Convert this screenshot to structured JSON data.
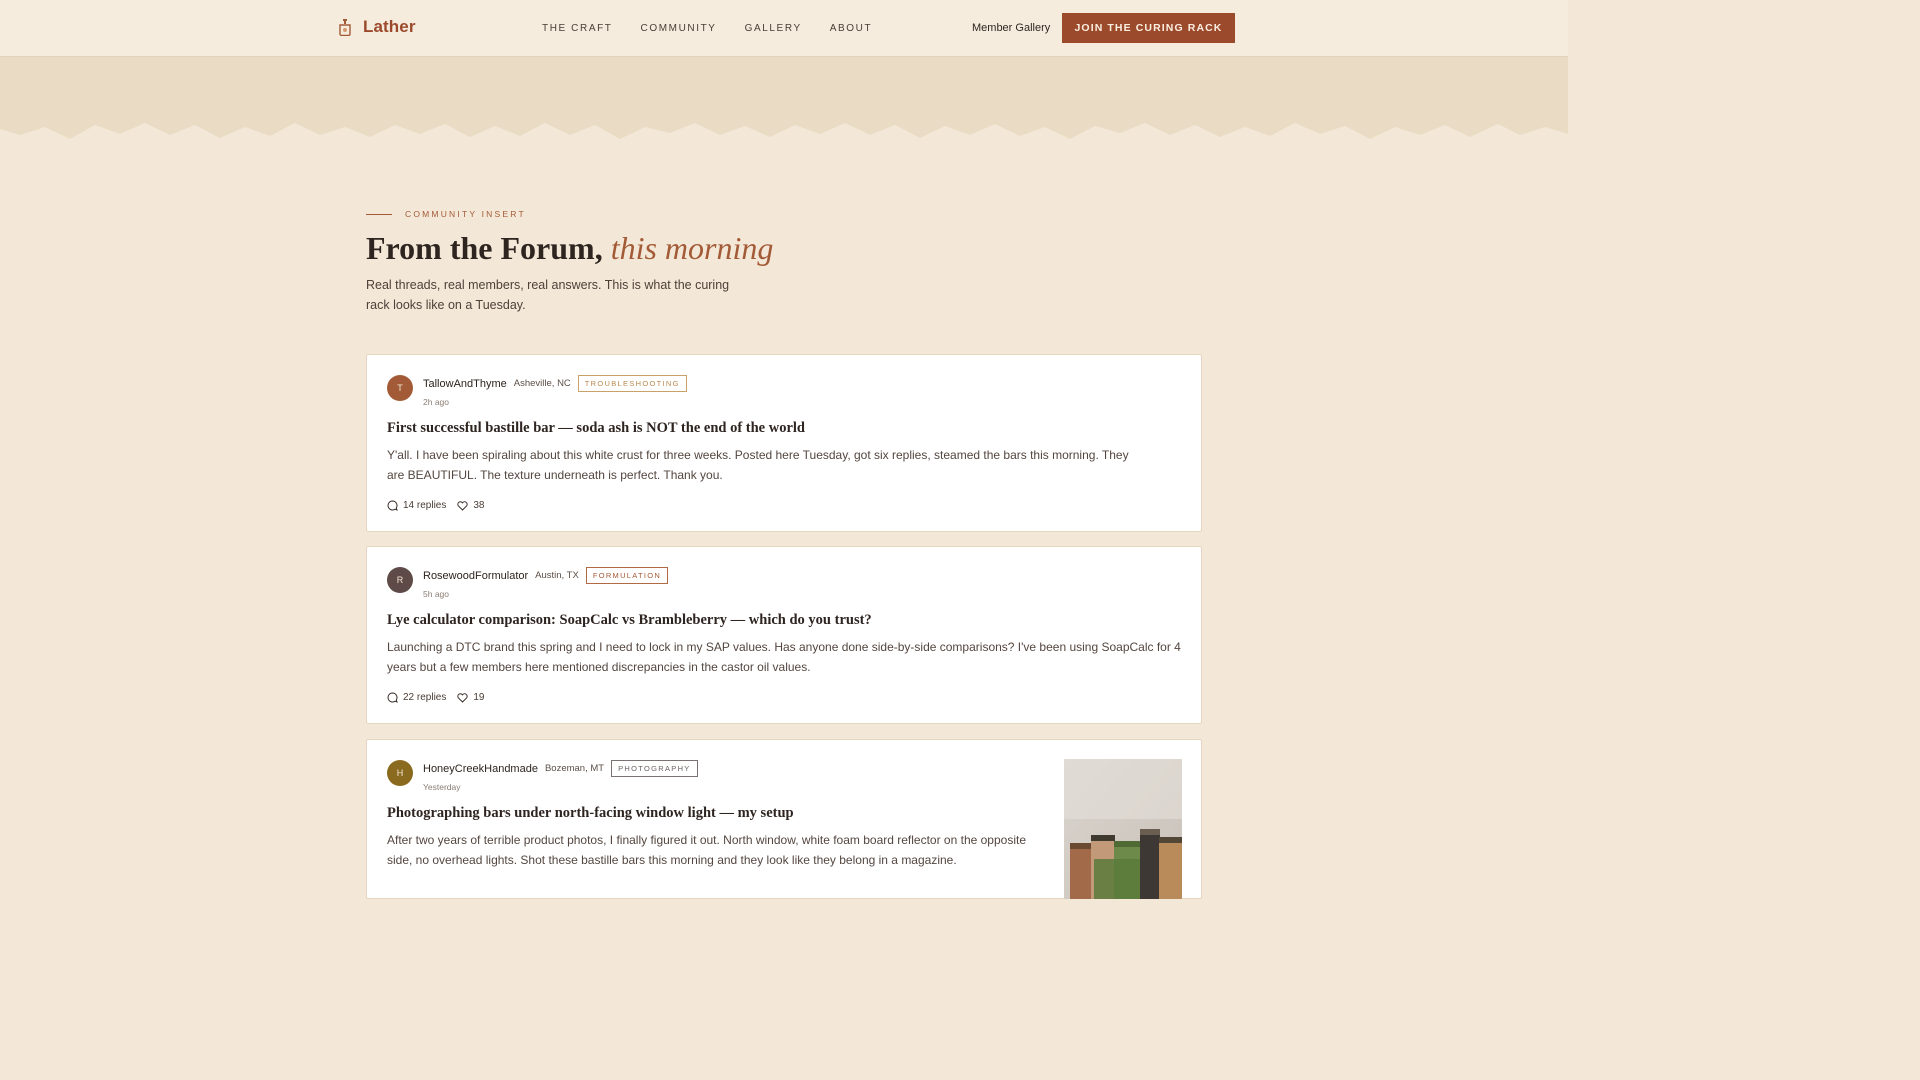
{
  "nav": {
    "brand": "Lather",
    "links": [
      "THE CRAFT",
      "COMMUNITY",
      "GALLERY",
      "ABOUT"
    ],
    "member_link": "Member Gallery",
    "cta": "JOIN THE CURING RACK"
  },
  "section": {
    "eyebrow": "COMMUNITY INSERT",
    "title_main": "From the Forum,",
    "title_emphasis": "this morning",
    "subtitle": "Real threads, real members, real answers. This is what the curing rack looks like on a Tuesday."
  },
  "posts": [
    {
      "initial": "T",
      "author": "TallowAndThyme",
      "location": "Asheville, NC",
      "tag": "TROUBLESHOOTING",
      "time": "2h ago",
      "title": "First successful bastille bar — soda ash is NOT the end of the world",
      "body": "Y'all. I have been spiraling about this white crust for three weeks. Posted here Tuesday, got six replies, steamed the bars this morning. They are BEAUTIFUL. The texture underneath is perfect. Thank you.",
      "replies": "14 replies",
      "likes": "38",
      "avatar_color": "#a35a37",
      "tag_color": "#c9a26a"
    },
    {
      "initial": "R",
      "author": "RosewoodFormulator",
      "location": "Austin, TX",
      "tag": "FORMULATION",
      "time": "5h ago",
      "title": "Lye calculator comparison: SoapCalc vs Brambleberry — which do you trust?",
      "body": "Launching a DTC brand this spring and I need to lock in my SAP values. Has anyone done side-by-side comparisons? I've been using SoapCalc for 4 years but a few members here mentioned discrepancies in the castor oil values.",
      "replies": "22 replies",
      "likes": "19",
      "avatar_color": "#5e4a47",
      "tag_color": "#a35a37"
    },
    {
      "initial": "H",
      "author": "HoneyCreekHandmade",
      "location": "Bozeman, MT",
      "tag": "PHOTOGRAPHY",
      "time": "Yesterday",
      "title": "Photographing bars under north-facing window light — my setup",
      "body": "After two years of terrible product photos, I finally figured it out. North window, white foam board reflector on the opposite side, no overhead lights. Shot these bastille bars this morning and they look like they belong in a magazine.",
      "avatar_color": "#8a6a1f",
      "tag_color": "#6b6462"
    }
  ],
  "icons": {
    "brand": "soap-dispenser-icon",
    "replies": "comment-icon",
    "likes": "heart-icon"
  },
  "colors": {
    "accent": "#9c4a2c",
    "background": "#f3e8d7",
    "card": "#ffffff"
  }
}
